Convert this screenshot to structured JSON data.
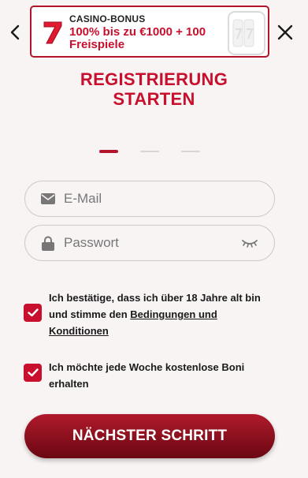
{
  "header": {
    "back_icon": "chevron-left-icon",
    "close_icon": "close-icon"
  },
  "banner": {
    "kicker": "CASINO-BONUS",
    "text": "100% bis zu €1000 + 100 Freispiele",
    "icon": "lucky-seven-icon",
    "accent": "#c8102e"
  },
  "title": {
    "line1": "REGISTRIERUNG",
    "line2": "STARTEN"
  },
  "steps": {
    "total": 3,
    "current": 1
  },
  "form": {
    "email": {
      "placeholder": "E-Mail",
      "value": "",
      "icon": "envelope-icon"
    },
    "password": {
      "placeholder": "Passwort",
      "value": "",
      "icon": "lock-icon",
      "toggle_icon": "eye-closed-icon"
    }
  },
  "consents": {
    "age": {
      "checked": true,
      "text_before": "Ich bestätige, dass ich über 18 Jahre alt bin und stimme den ",
      "link": "Bedingungen und Konditionen",
      "text_after": ""
    },
    "newsletter": {
      "checked": true,
      "text": "Ich möchte jede Woche kostenlose Boni erhalten"
    }
  },
  "cta": {
    "label": "NÄCHSTER SCHRITT"
  },
  "colors": {
    "brand_red": "#c8102e",
    "button_dark": "#6a0712",
    "background": "#f8f4f4"
  }
}
